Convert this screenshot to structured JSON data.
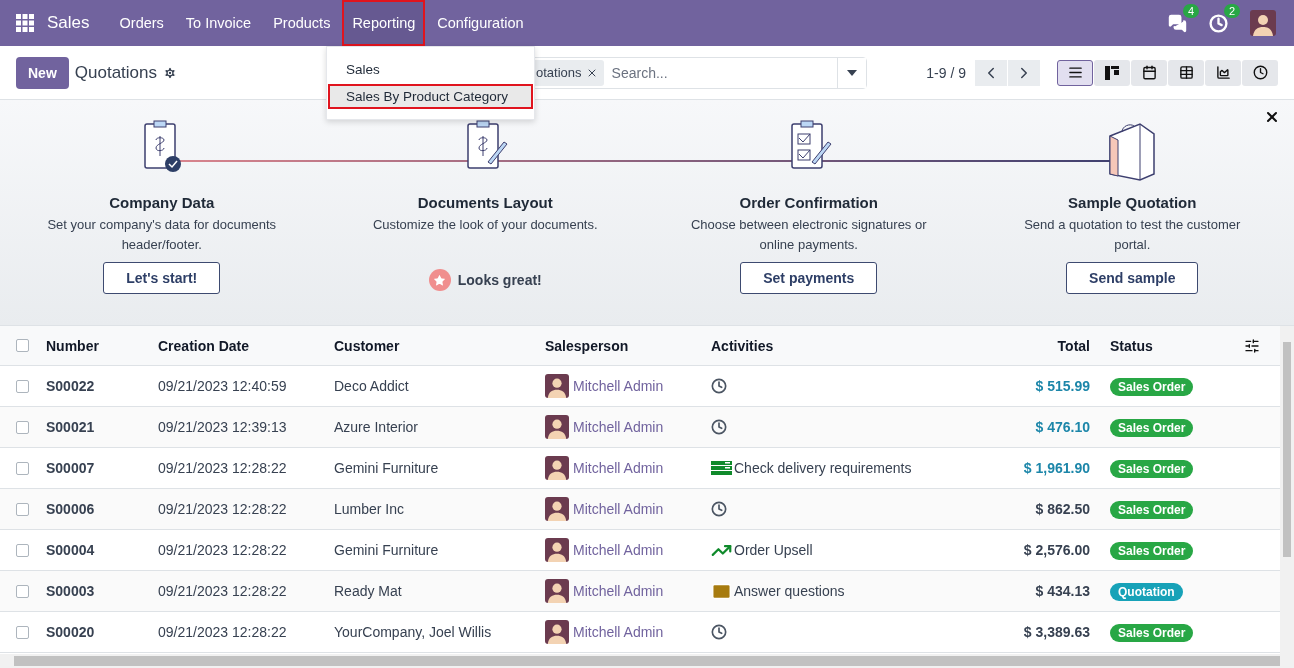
{
  "navbar": {
    "app": "Sales",
    "menus": [
      {
        "label": "Orders",
        "open": false,
        "highlighted": false
      },
      {
        "label": "To Invoice",
        "open": false,
        "highlighted": false
      },
      {
        "label": "Products",
        "open": false,
        "highlighted": false
      },
      {
        "label": "Reporting",
        "open": true,
        "highlighted": true
      },
      {
        "label": "Configuration",
        "open": false,
        "highlighted": false
      }
    ],
    "messages_badge": "4",
    "activities_badge": "2"
  },
  "dropdown": {
    "items": [
      {
        "label": "Sales",
        "selected": false,
        "highlighted": false
      },
      {
        "label": "Sales By Product Category",
        "selected": true,
        "highlighted": true
      }
    ]
  },
  "control_panel": {
    "new_button": "New",
    "title": "Quotations",
    "facet": "otations",
    "search": {
      "placeholder": "Search..."
    },
    "pager": "1-9 / 9",
    "views": [
      {
        "kind": "list",
        "selected": true
      },
      {
        "kind": "kanban",
        "selected": false
      },
      {
        "kind": "calendar",
        "selected": false
      },
      {
        "kind": "pivot",
        "selected": false
      },
      {
        "kind": "graph",
        "selected": false
      },
      {
        "kind": "activity",
        "selected": false
      }
    ]
  },
  "onboarding": {
    "steps": [
      {
        "kind": "button",
        "title": "Company Data",
        "description": "Set your company's data for documents header/footer.",
        "action": "Let's start!"
      },
      {
        "kind": "done",
        "title": "Documents Layout",
        "description": "Customize the look of your documents.",
        "action": "Looks great!"
      },
      {
        "kind": "button",
        "title": "Order Confirmation",
        "description": "Choose between electronic signatures or online payments.",
        "action": "Set payments"
      },
      {
        "kind": "button",
        "title": "Sample Quotation",
        "description": "Send a quotation to test the customer portal.",
        "action": "Send sample"
      }
    ]
  },
  "table": {
    "columns": [
      "Number",
      "Creation Date",
      "Customer",
      "Salesperson",
      "Activities",
      "Total",
      "Status"
    ],
    "all_checked": false,
    "rows": [
      {
        "checked": false,
        "number": "S00022",
        "date": "09/21/2023 12:40:59",
        "customer": "Deco Addict",
        "salesperson": "Mitchell Admin",
        "activity": {
          "kind": "none"
        },
        "total": "$ 515.99",
        "accent": true,
        "status": "Sales Order",
        "color": "#28a745"
      },
      {
        "checked": false,
        "number": "S00021",
        "date": "09/21/2023 12:39:13",
        "customer": "Azure Interior",
        "salesperson": "Mitchell Admin",
        "activity": {
          "kind": "none"
        },
        "total": "$ 476.10",
        "accent": true,
        "status": "Sales Order",
        "color": "#28a745"
      },
      {
        "checked": false,
        "number": "S00007",
        "date": "09/21/2023 12:28:22",
        "customer": "Gemini Furniture",
        "salesperson": "Mitchell Admin",
        "activity": {
          "kind": "todo",
          "label": "Check delivery requirements"
        },
        "total": "$ 1,961.90",
        "accent": true,
        "status": "Sales Order",
        "color": "#28a745"
      },
      {
        "checked": false,
        "number": "S00006",
        "date": "09/21/2023 12:28:22",
        "customer": "Lumber Inc",
        "salesperson": "Mitchell Admin",
        "activity": {
          "kind": "none"
        },
        "total": "$ 862.50",
        "accent": false,
        "status": "Sales Order",
        "color": "#28a745"
      },
      {
        "checked": false,
        "number": "S00004",
        "date": "09/21/2023 12:28:22",
        "customer": "Gemini Furniture",
        "salesperson": "Mitchell Admin",
        "activity": {
          "kind": "upsell",
          "label": "Order Upsell"
        },
        "total": "$ 2,576.00",
        "accent": false,
        "status": "Sales Order",
        "color": "#28a745"
      },
      {
        "checked": false,
        "number": "S00003",
        "date": "09/21/2023 12:28:22",
        "customer": "Ready Mat",
        "salesperson": "Mitchell Admin",
        "activity": {
          "kind": "email",
          "label": "Answer questions"
        },
        "total": "$ 434.13",
        "accent": false,
        "status": "Quotation",
        "color": "#17a2b8"
      },
      {
        "checked": false,
        "number": "S00020",
        "date": "09/21/2023 12:28:22",
        "customer": "YourCompany, Joel Willis",
        "salesperson": "Mitchell Admin",
        "activity": {
          "kind": "none"
        },
        "total": "$ 3,389.63",
        "accent": false,
        "status": "Sales Order",
        "color": "#28a745"
      }
    ]
  }
}
